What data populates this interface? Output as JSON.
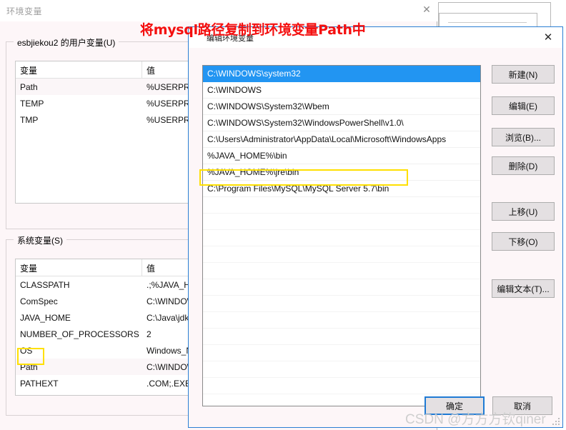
{
  "background_window": {
    "title": "环境变量",
    "close_icon": "close-icon",
    "user_group_label": "esbjiekou2 的用户变量(U)",
    "system_group_label": "系统变量(S)",
    "columns": [
      "变量",
      "值"
    ],
    "user_variables": [
      {
        "name": "Path",
        "value": "%USERPRO"
      },
      {
        "name": "TEMP",
        "value": "%USERPRO"
      },
      {
        "name": "TMP",
        "value": "%USERPRO"
      }
    ],
    "system_variables": [
      {
        "name": "CLASSPATH",
        "value": ".;%JAVA_HO"
      },
      {
        "name": "ComSpec",
        "value": "C:\\WINDOW"
      },
      {
        "name": "JAVA_HOME",
        "value": "C:\\Java\\jdk"
      },
      {
        "name": "NUMBER_OF_PROCESSORS",
        "value": "2"
      },
      {
        "name": "OS",
        "value": "Windows_N"
      },
      {
        "name": "Path",
        "value": "C:\\WINDOW"
      },
      {
        "name": "PATHEXT",
        "value": ".COM;.EXE;"
      }
    ],
    "highlighted_system_variable": "Path"
  },
  "middle_window": {
    "close_icon": "close-icon"
  },
  "dialog": {
    "title": "编辑环境变量",
    "close_icon": "close-icon",
    "entries": [
      "C:\\WINDOWS\\system32",
      "C:\\WINDOWS",
      "C:\\WINDOWS\\System32\\Wbem",
      "C:\\WINDOWS\\System32\\WindowsPowerShell\\v1.0\\",
      "C:\\Users\\Administrator\\AppData\\Local\\Microsoft\\WindowsApps",
      "%JAVA_HOME%\\bin",
      "%JAVA_HOME%\\jre\\bin",
      "C:\\Program Files\\MySQL\\MySQL Server 5.7\\bin"
    ],
    "selected_index": 0,
    "highlighted_entry": "C:\\Program Files\\MySQL\\MySQL Server 5.7\\bin",
    "side_buttons": [
      {
        "id": "new",
        "label": "新建(N)"
      },
      {
        "id": "edit",
        "label": "编辑(E)"
      },
      {
        "id": "browse",
        "label": "浏览(B)..."
      },
      {
        "id": "delete",
        "label": "删除(D)"
      },
      {
        "id": "move-up",
        "label": "上移(U)"
      },
      {
        "id": "move-down",
        "label": "下移(O)"
      },
      {
        "id": "edit-text",
        "label": "编辑文本(T)..."
      }
    ],
    "ok_label": "确定",
    "cancel_label": "取消"
  },
  "annotation": {
    "text": "将mysql路径复制到环境变量Path中",
    "color": "#f40f0f"
  },
  "watermark": {
    "text": "CSDN @方方方钦qiner"
  },
  "colors": {
    "accent": "#2295f2",
    "dialog_border": "#2a7fd4",
    "highlight_box": "#ffe000",
    "window_bg": "#fdf6f8",
    "button_face": "#e4e0e2"
  }
}
